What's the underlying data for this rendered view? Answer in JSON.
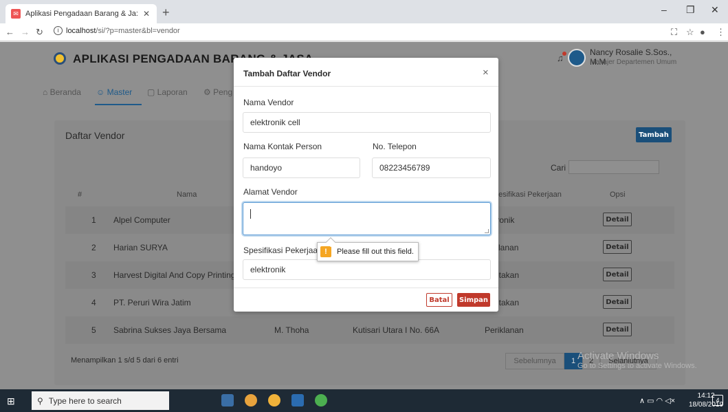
{
  "browser": {
    "tab_title": "Aplikasi Pengadaan Barang & Ja:",
    "url_host": "localhost",
    "url_path": "/si/?p=master&bl=vendor"
  },
  "app": {
    "title": "APLIKASI PENGADAAN BARANG & JASA",
    "user_name": "Nancy Rosalie S.Sos., M.M",
    "user_role": "Manajer Departemen Umum"
  },
  "menu": {
    "items": [
      {
        "label": "Beranda",
        "icon": "home-icon"
      },
      {
        "label": "Master",
        "icon": "user-icon"
      },
      {
        "label": "Laporan",
        "icon": "document-icon"
      },
      {
        "label": "Peng",
        "icon": "gear-icon"
      }
    ]
  },
  "card": {
    "title": "Daftar Vendor",
    "add_button": "Tambah",
    "search_label": "Cari",
    "columns": [
      "#",
      "Nama",
      "pesifikasi Pekerjaan",
      "Opsi"
    ],
    "rows": [
      {
        "no": "1",
        "nama": "Alpel Computer",
        "spesifikasi": "tronik",
        "action": "Detail"
      },
      {
        "no": "2",
        "nama": "Harian SURYA",
        "spesifikasi": "klanan",
        "action": "Detail"
      },
      {
        "no": "3",
        "nama": "Harvest Digital And Copy Printing",
        "spesifikasi": "etakan",
        "action": "Detail"
      },
      {
        "no": "4",
        "nama": "PT. Peruri Wira Jatim",
        "spesifikasi": "etakan",
        "action": "Detail"
      },
      {
        "no": "5",
        "nama": "Sabrina Sukses Jaya Bersama",
        "kontak": "M. Thoha",
        "alamat": "Kutisari Utara I No. 66A",
        "spesifikasi": "Periklanan",
        "action": "Detail"
      }
    ],
    "footer_info": "Menampilkan 1 s/d 5 dari 6 entri",
    "pager": {
      "prev": "Sebelumnya",
      "p1": "1",
      "p2": "2",
      "next": "Selanjutnya"
    }
  },
  "modal": {
    "title": "Tambah Daftar Vendor",
    "close": "×",
    "fields": {
      "nama_vendor_label": "Nama Vendor",
      "nama_vendor_value": "elektronik cell",
      "kontak_label": "Nama Kontak Person",
      "kontak_value": "handoyo",
      "telepon_label": "No. Telepon",
      "telepon_value": "08223456789",
      "alamat_label": "Alamat Vendor",
      "alamat_value": "",
      "spesifikasi_label": "Spesifikasi Pekerjaan",
      "spesifikasi_value": "elektronik"
    },
    "batal": "Batal",
    "simpan": "Simpan",
    "tooltip": "Please fill out this field."
  },
  "watermark": {
    "line1": "Activate Windows",
    "line2": "Go to Settings to activate Windows."
  },
  "taskbar": {
    "search_placeholder": "Type here to search",
    "time": "14:12",
    "date": "18/08/2019",
    "notif_count": "4"
  },
  "colors": {
    "primary": "#1a4f7a",
    "danger": "#c0392b",
    "focus": "#5b9bd5"
  }
}
